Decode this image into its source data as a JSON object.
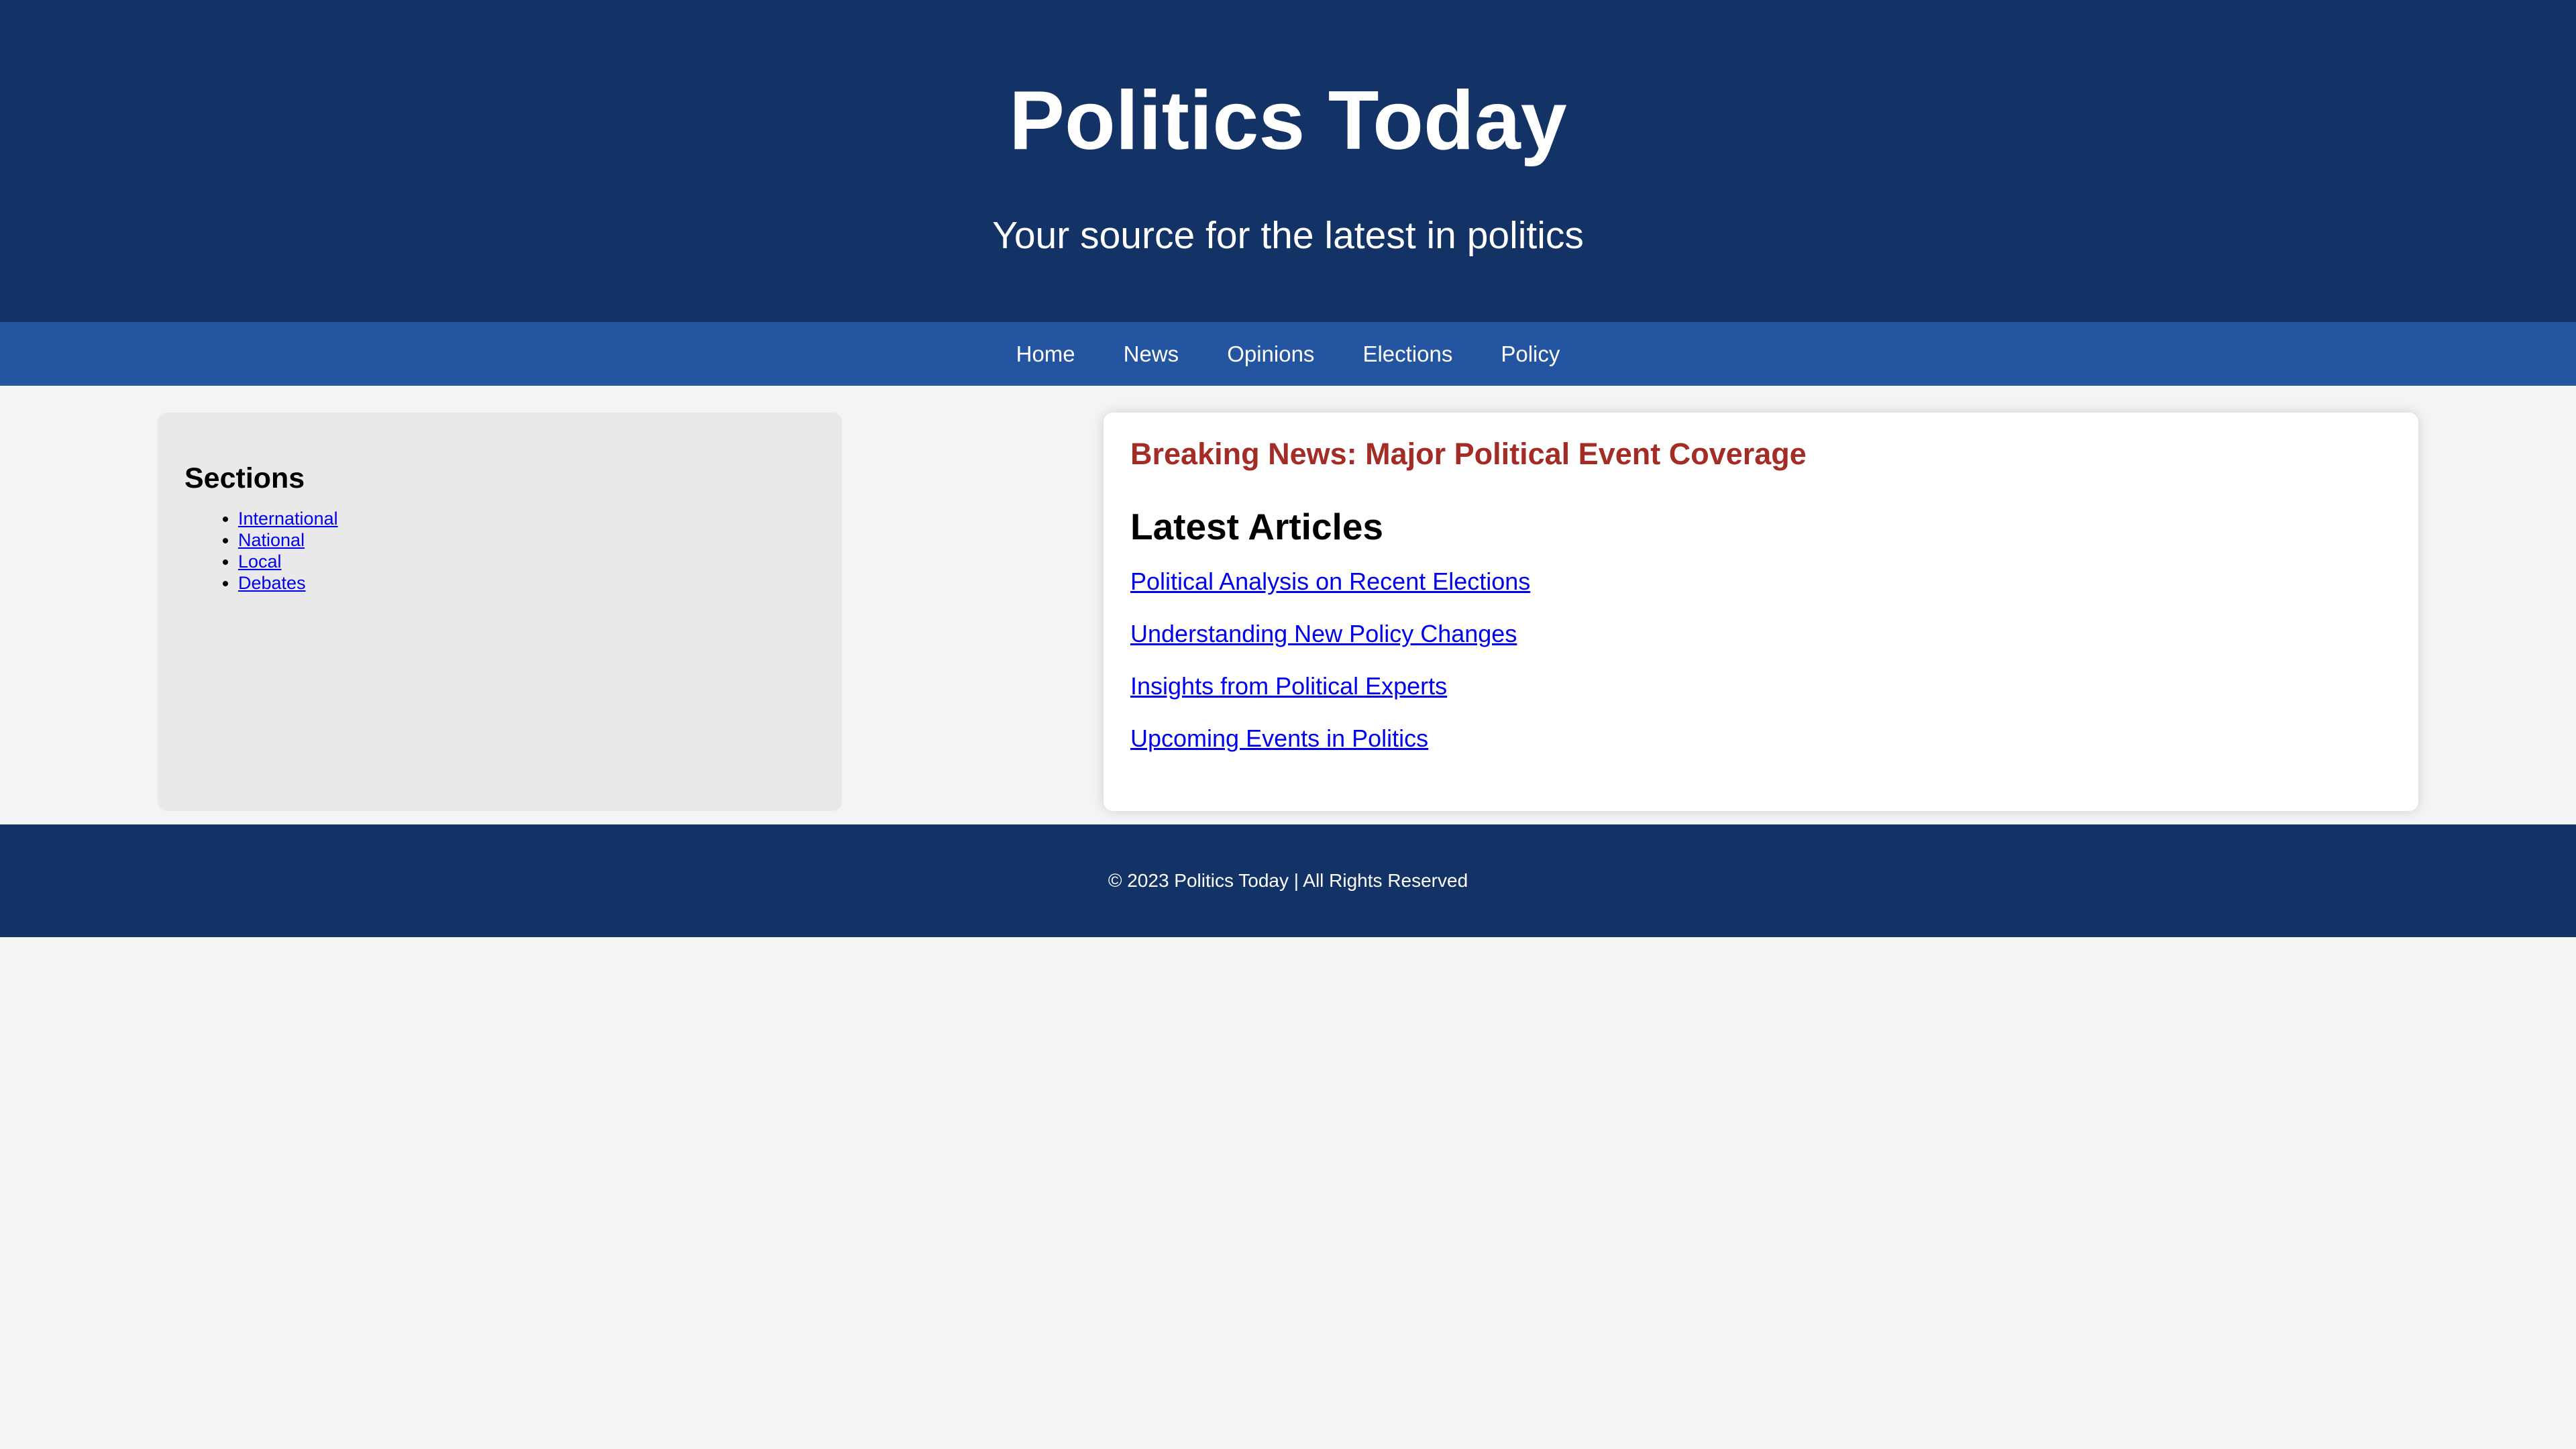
{
  "header": {
    "title": "Politics Today",
    "tagline": "Your source for the latest in politics"
  },
  "nav": {
    "items": [
      "Home",
      "News",
      "Opinions",
      "Elections",
      "Policy"
    ]
  },
  "sidebar": {
    "heading": "Sections",
    "items": [
      "International",
      "National",
      "Local",
      "Debates"
    ]
  },
  "main": {
    "breaking": "Breaking News: Major Political Event Coverage",
    "latest_heading": "Latest Articles",
    "articles": [
      "Political Analysis on Recent Elections",
      "Understanding New Policy Changes",
      "Insights from Political Experts",
      "Upcoming Events in Politics"
    ]
  },
  "footer": {
    "text": "© 2023 Politics Today | All Rights Reserved"
  },
  "colors": {
    "header_bg": "#133366",
    "nav_bg": "#2455a1",
    "breaking": "#a32d26",
    "link": "#0000ee",
    "page_bg": "#f4f4f4",
    "sidebar_bg": "#e9e9e9"
  }
}
